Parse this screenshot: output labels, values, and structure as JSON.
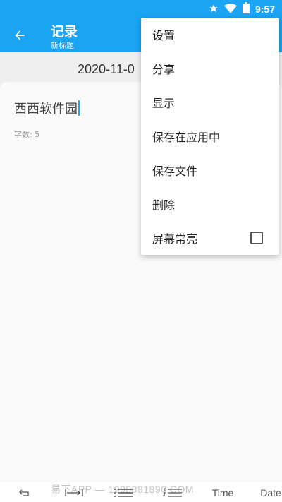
{
  "status_bar": {
    "time": "9:57",
    "icons": [
      "star-icon",
      "wifi-icon",
      "battery-icon"
    ]
  },
  "app_bar": {
    "title": "记录",
    "subtitle": "新标题",
    "back_icon": "arrow-left-icon"
  },
  "date": "2020-11-0",
  "editor": {
    "content": "西西软件园",
    "word_count": "字数: 5"
  },
  "menu": {
    "items": [
      {
        "label": "设置"
      },
      {
        "label": "分享"
      },
      {
        "label": "显示"
      },
      {
        "label": "保存在应用中"
      },
      {
        "label": "保存文件"
      },
      {
        "label": "删除"
      },
      {
        "label": "屏幕常亮",
        "checked": false
      }
    ]
  },
  "bottom_bar": {
    "time_label": "Time",
    "date_label": "Date",
    "watermark": "易下APP — 1998881890.COM"
  },
  "colors": {
    "primary": "#1aa4f2",
    "background": "#efefef",
    "card": "#fafafa"
  }
}
